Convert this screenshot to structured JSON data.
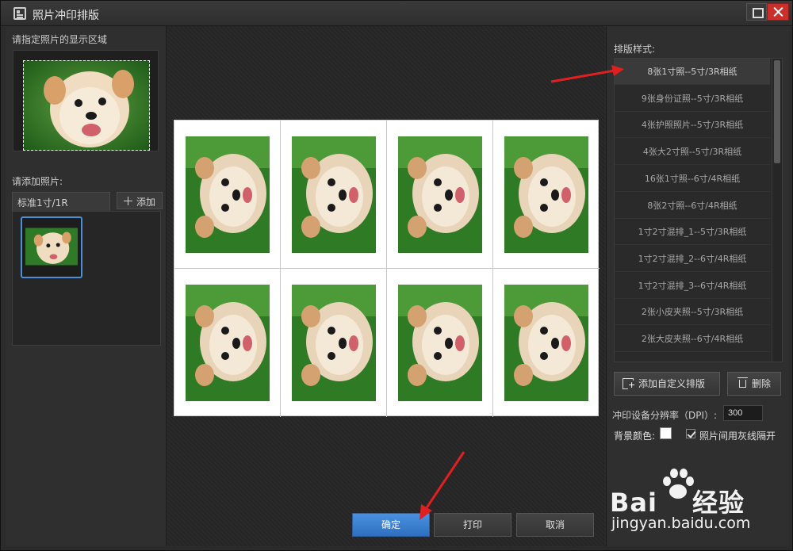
{
  "window": {
    "title": "照片冲印排版"
  },
  "left_panel": {
    "display_area_label": "请指定照片的显示区域",
    "add_photo_label": "请添加照片:",
    "tab_label": "标准1寸/1R",
    "add_button": "添加"
  },
  "preview": {
    "rows": 2,
    "cols": 4
  },
  "bottom_buttons": {
    "confirm": "确定",
    "print": "打印",
    "cancel": "取消"
  },
  "right_panel": {
    "layout_style_label": "排版样式:",
    "layout_items": [
      "8张1寸照--5寸/3R相纸",
      "9张身份证照--5寸/3R相纸",
      "4张护照照片--5寸/3R相纸",
      "4张大2寸照--5寸/3R相纸",
      "16张1寸照--6寸/4R相纸",
      "8张2寸照--6寸/4R相纸",
      "1寸2寸混排_1--5寸/3R相纸",
      "1寸2寸混排_2--6寸/4R相纸",
      "1寸2寸混排_3--6寸/4R相纸",
      "2张小皮夹照--5寸/3R相纸",
      "2张大皮夹照--6寸/4R相纸"
    ],
    "selected_index": 0,
    "add_custom_button": "添加自定义排版",
    "delete_button": "删除",
    "dpi_label": "冲印设备分辨率（DPI）:",
    "dpi_value": "300",
    "bg_color_label": "背景颜色:",
    "bg_color": "#ffffff",
    "gray_line_label": "照片间用灰线隔开",
    "gray_line_checked": true
  },
  "watermark": {
    "logo_text": "Bai",
    "logo_text_2": "经验",
    "url": "jingyan.baidu.com"
  },
  "colors": {
    "accent": "#3a7fd0",
    "arrow": "#e02020",
    "close": "#c9302c"
  },
  "icons": [
    "app-icon",
    "maximize-icon",
    "close-icon",
    "plus-icon",
    "add-layout-icon",
    "trash-icon",
    "checkbox-check-icon",
    "baidu-paw-icon"
  ]
}
